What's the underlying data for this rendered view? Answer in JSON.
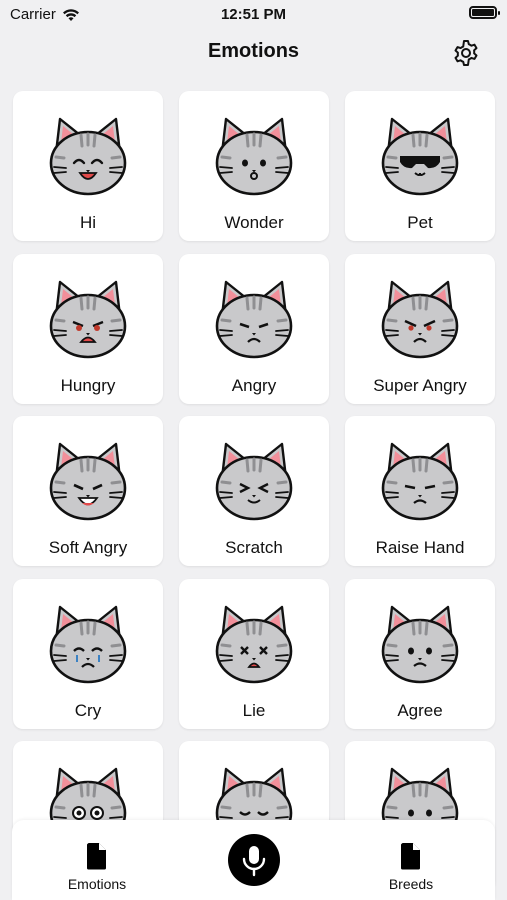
{
  "status": {
    "carrier": "Carrier",
    "time": "12:51 PM"
  },
  "header": {
    "title": "Emotions"
  },
  "emotions": [
    {
      "label": "Hi",
      "face": "hi"
    },
    {
      "label": "Wonder",
      "face": "wonder"
    },
    {
      "label": "Pet",
      "face": "pet"
    },
    {
      "label": "Hungry",
      "face": "hungry"
    },
    {
      "label": "Angry",
      "face": "angry"
    },
    {
      "label": "Super Angry",
      "face": "superangry"
    },
    {
      "label": "Soft Angry",
      "face": "softangry"
    },
    {
      "label": "Scratch",
      "face": "scratch"
    },
    {
      "label": "Raise Hand",
      "face": "raisehand"
    },
    {
      "label": "Cry",
      "face": "cry"
    },
    {
      "label": "Lie",
      "face": "lie"
    },
    {
      "label": "Agree",
      "face": "agree"
    },
    {
      "label": "",
      "face": "surprised"
    },
    {
      "label": "",
      "face": "sleepy"
    },
    {
      "label": "",
      "face": "calm"
    }
  ],
  "tabbar": {
    "emotions_label": "Emotions",
    "breeds_label": "Breeds"
  },
  "colors": {
    "accent": "#000000",
    "background": "#f0f0f2",
    "card": "#ffffff",
    "ear_inner": "#f28f9a",
    "fur": "#c9c9cb",
    "stripes": "#8f8f92"
  },
  "icons": {
    "settings": "gear-icon",
    "emotions_tab": "document-icon",
    "mic": "microphone-icon",
    "breeds_tab": "document-icon"
  }
}
